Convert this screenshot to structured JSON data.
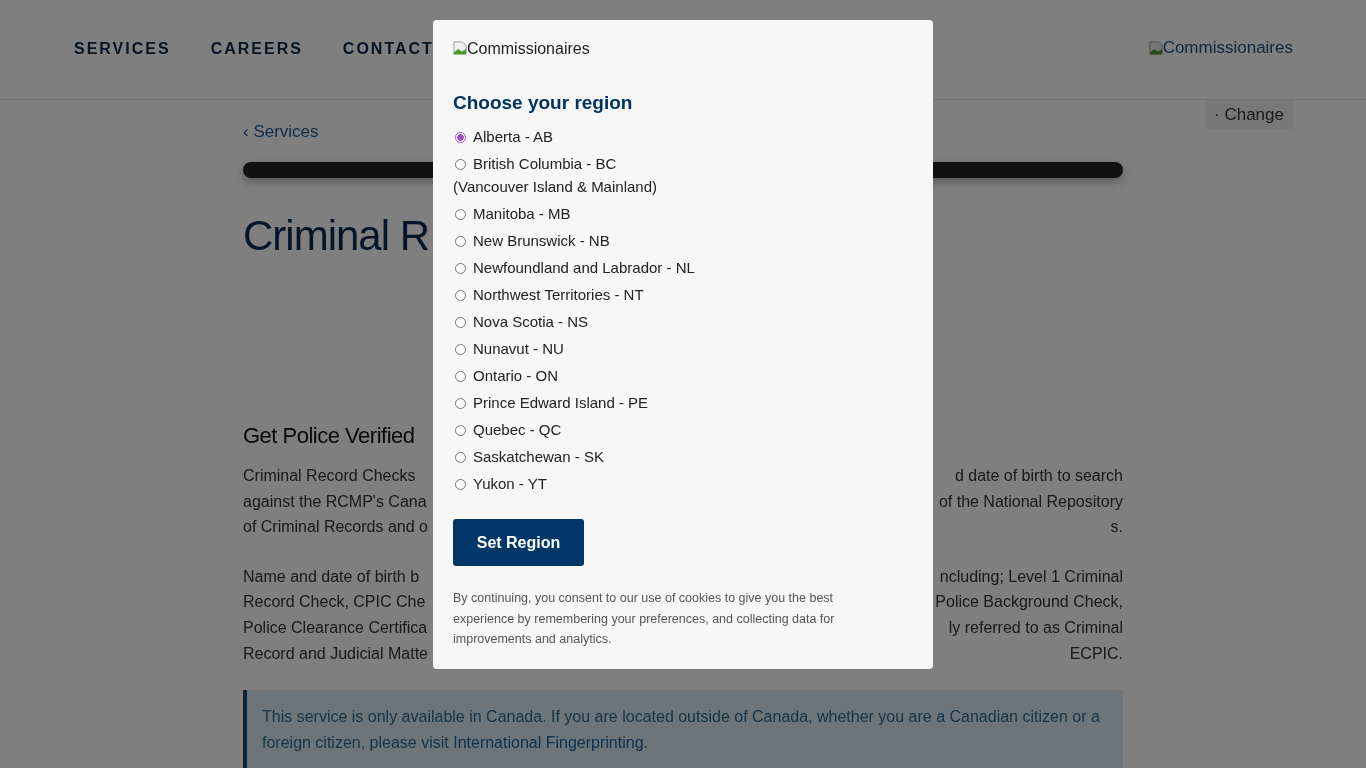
{
  "header": {
    "nav": [
      "SERVICES",
      "CAREERS",
      "CONTACT"
    ],
    "logo_alt": "Commissionaires"
  },
  "region_button": "· Change",
  "breadcrumb": "‹ Services",
  "page": {
    "title": "Criminal R",
    "subtitle": "Get Police Verified",
    "paragraphs": [
      [
        {
          "left": "Criminal Record Checks",
          "right": "d date of birth to search"
        },
        {
          "left": "against the RCMP's Cana",
          "right": "of the National Repository"
        },
        {
          "left": "of Criminal Records and o",
          "right": "s."
        }
      ],
      [
        {
          "left": "Name and date of birth b",
          "right": "ncluding; Level 1 Criminal"
        },
        {
          "left": "Record Check, CPIC Che",
          "right": "Police Background Check,"
        },
        {
          "left": "Police Clearance Certifica",
          "right": "ly referred to as Criminal"
        },
        {
          "left": "Record and Judicial Matte",
          "right": "ECPIC."
        }
      ]
    ],
    "notice": {
      "text": "This service is only available in Canada. If you are located outside of Canada, whether you are a Canadian citizen or a foreign citizen, please visit ",
      "link": "International Fingerprinting",
      "end": "."
    }
  },
  "modal": {
    "logo_alt": "Commissionaires",
    "title": "Choose your region",
    "regions": [
      {
        "label": "Alberta - AB",
        "selected": true
      },
      {
        "label": "British Columbia - BC",
        "sublabel": "(Vancouver Island & Mainland)",
        "selected": false
      },
      {
        "label": "Manitoba - MB",
        "selected": false
      },
      {
        "label": "New Brunswick - NB",
        "selected": false
      },
      {
        "label": "Newfoundland and Labrador - NL",
        "selected": false
      },
      {
        "label": "Northwest Territories - NT",
        "selected": false
      },
      {
        "label": "Nova Scotia - NS",
        "selected": false
      },
      {
        "label": "Nunavut - NU",
        "selected": false
      },
      {
        "label": "Ontario - ON",
        "selected": false
      },
      {
        "label": "Prince Edward Island - PE",
        "selected": false
      },
      {
        "label": "Quebec - QC",
        "selected": false
      },
      {
        "label": "Saskatchewan - SK",
        "selected": false
      },
      {
        "label": "Yukon - YT",
        "selected": false
      }
    ],
    "button": "Set Region",
    "consent": "By continuing, you consent to our use of cookies to give you the best experience by remembering your preferences, and collecting data for improvements and analytics."
  }
}
